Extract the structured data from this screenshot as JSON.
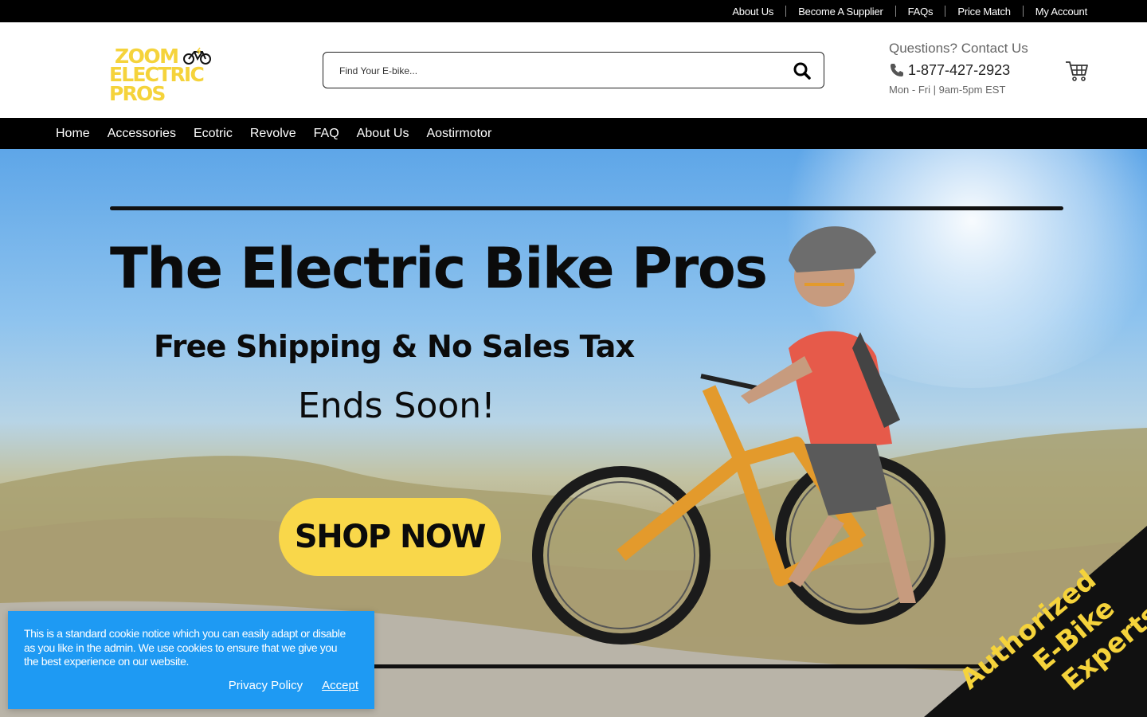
{
  "topbar": {
    "links": [
      "About Us",
      "Become A Supplier",
      "FAQs",
      "Price Match",
      "My Account"
    ]
  },
  "header": {
    "logo_line1": "ZOOM",
    "logo_line2": "ELECTRIC PROS",
    "search_placeholder": "Find Your E-bike...",
    "contact_question": "Questions? Contact Us",
    "phone": "1-877-427-2923",
    "hours": "Mon - Fri | 9am-5pm EST",
    "icons": {
      "search": "search-icon",
      "phone": "phone-icon",
      "cart": "cart-icon",
      "logo": "bicycle-icon"
    }
  },
  "nav": {
    "items": [
      "Home",
      "Accessories",
      "Ecotric",
      "Revolve",
      "FAQ",
      "About Us",
      "Aostirmotor"
    ]
  },
  "hero": {
    "title": "The Electric Bike Pros",
    "subtitle": "Free Shipping & No Sales Tax",
    "tagline": "Ends Soon!",
    "cta": "SHOP NOW",
    "ribbon_line1": "Authorized",
    "ribbon_line2": "E-Bike",
    "ribbon_line3": "Experts"
  },
  "cookie": {
    "text": "This is a standard cookie notice which you can easily adapt or disable as you like in the admin. We use cookies to ensure that we give you the best experience on our website.",
    "privacy_label": "Privacy Policy",
    "accept_label": "Accept"
  },
  "colors": {
    "brand_yellow": "#f5d33b",
    "cta_yellow": "#f9d74a",
    "cookie_blue": "#1e9af3",
    "bar_black": "#000000"
  }
}
